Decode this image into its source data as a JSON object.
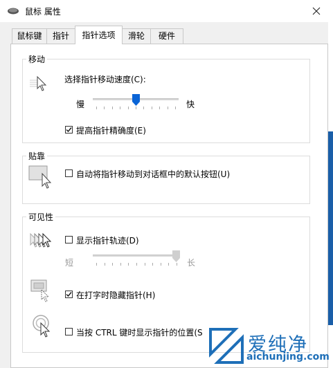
{
  "window": {
    "title": "鼠标 属性"
  },
  "tabs": [
    {
      "label": "鼠标键"
    },
    {
      "label": "指针"
    },
    {
      "label": "指针选项",
      "active": true
    },
    {
      "label": "滑轮"
    },
    {
      "label": "硬件"
    }
  ],
  "motion": {
    "legend": "移动",
    "speed_label": "选择指针移动速度(C):",
    "slow_label": "慢",
    "fast_label": "快",
    "speed_value": 0.5,
    "precision_label": "提高指针精确度(E)",
    "precision_checked": true
  },
  "snap": {
    "legend": "贴靠",
    "snap_label": "自动将指针移动到对话框中的默认按钮(U)",
    "snap_checked": false
  },
  "visibility": {
    "legend": "可见性",
    "trails_label": "显示指针轨迹(D)",
    "trails_checked": false,
    "short_label": "短",
    "long_label": "长",
    "trail_value": 1.0,
    "hide_label": "在打字时隐藏指针(H)",
    "hide_checked": true,
    "ctrl_label": "当按 CTRL 键时显示指针的位置(S",
    "ctrl_checked": false
  },
  "watermark": {
    "title": "爱纯净",
    "url": "aichunjing.com"
  },
  "colors": {
    "accent": "#0a64d6",
    "watermark": "#1e6fb8"
  }
}
